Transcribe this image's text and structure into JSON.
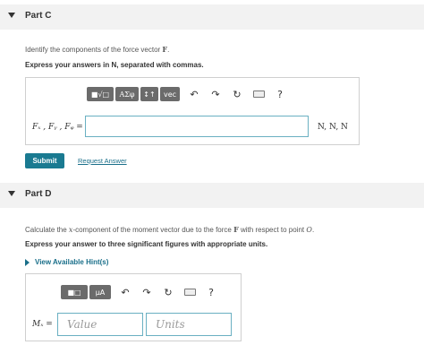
{
  "partC": {
    "title": "Part C",
    "prompt_text": "Identify the components of the force vector ",
    "prompt_vector": "F",
    "prompt_end": ".",
    "instruction": "Express your answers in N, separated with commas.",
    "toolbar": {
      "matrix_label": "■√□",
      "greek_label": "AΣφ",
      "arrows_label": "↕↑",
      "vec_label": "vec",
      "undo": "↶",
      "redo": "↷",
      "reset": "↻",
      "help": "?"
    },
    "input_label": "Fₓ , Fᵧ , Fᵩ =",
    "input_value": "",
    "units": "N, N, N",
    "submit_label": "Submit",
    "request_answer_label": "Request Answer"
  },
  "partD": {
    "title": "Part D",
    "prompt_pre": "Calculate the ",
    "prompt_var": "x",
    "prompt_mid": "-component of the moment vector due to the force ",
    "prompt_vector": "F",
    "prompt_post": " with respect to point ",
    "prompt_point": "O",
    "prompt_end": ".",
    "instruction": "Express your answer to three significant figures with appropriate units.",
    "hint_label": "View Available Hint(s)",
    "toolbar": {
      "matrix_label": "■□",
      "mu_label": "μA",
      "undo": "↶",
      "redo": "↷",
      "reset": "↻",
      "help": "?"
    },
    "input_label": "Mₓ =",
    "value_placeholder": "Value",
    "units_placeholder": "Units"
  },
  "colors": {
    "accent": "#1a7a91",
    "toolbar": "#6b6b6b",
    "input_border": "#6ab0c2",
    "header_bg": "#f2f2f2"
  }
}
